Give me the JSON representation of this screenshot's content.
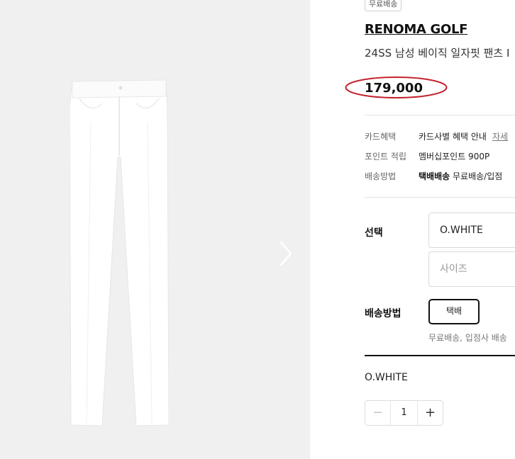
{
  "gallery": {
    "image_icon": "white-pants-product-image",
    "next_icon": "chevron-right-icon"
  },
  "product": {
    "badge": "무료배송",
    "brand": "RENOMA GOLF",
    "name": "24SS 남성 베이직 일자핏 팬츠 I",
    "price": "179,000",
    "price_annotation_color": "#c4232e"
  },
  "benefits": {
    "card_label": "카드혜택",
    "card_value": "카드사별 혜택 안내",
    "card_link": "자세",
    "point_label": "포인트 적립",
    "point_value": "멤버십포인트 900P",
    "ship_label": "배송방법",
    "ship_value_bold": "택배배송",
    "ship_value": "무료배송/입점"
  },
  "options": {
    "select_label": "선택",
    "color_value": "O.WHITE",
    "size_placeholder": "사이즈",
    "shipping_label": "배송방법",
    "shipping_button": "택배",
    "shipping_note": "무료배송, 입점사 배송"
  },
  "selected": {
    "option_name": "O.WHITE",
    "quantity": "1",
    "minus": "−",
    "plus": "+"
  }
}
